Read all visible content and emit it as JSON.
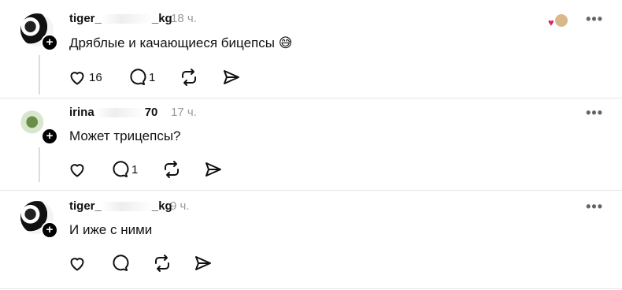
{
  "comments": [
    {
      "username_prefix": "tiger_",
      "username_suffix": "_kg",
      "time": "18 ч.",
      "text": "Дряблые и качающиеся бицепсы",
      "emoji": "😅",
      "likes": "16",
      "replies": "1",
      "liked_by_author": true
    },
    {
      "username_prefix": "irina",
      "username_suffix": "70",
      "time": "17 ч.",
      "text": "Может трицепсы?",
      "likes": "",
      "replies": "1"
    },
    {
      "username_prefix": "tiger_",
      "username_suffix": "_kg",
      "time": "9 ч.",
      "text": "И иже с ними",
      "likes": "",
      "replies": ""
    }
  ],
  "ui": {
    "more_glyph": "•••",
    "plus_glyph": "+",
    "heart_glyph": "♥",
    "icons": [
      "heart-icon",
      "comment-icon",
      "repost-icon",
      "share-icon",
      "more-icon",
      "follow-plus-icon"
    ],
    "accent_like": "#e0245e"
  }
}
